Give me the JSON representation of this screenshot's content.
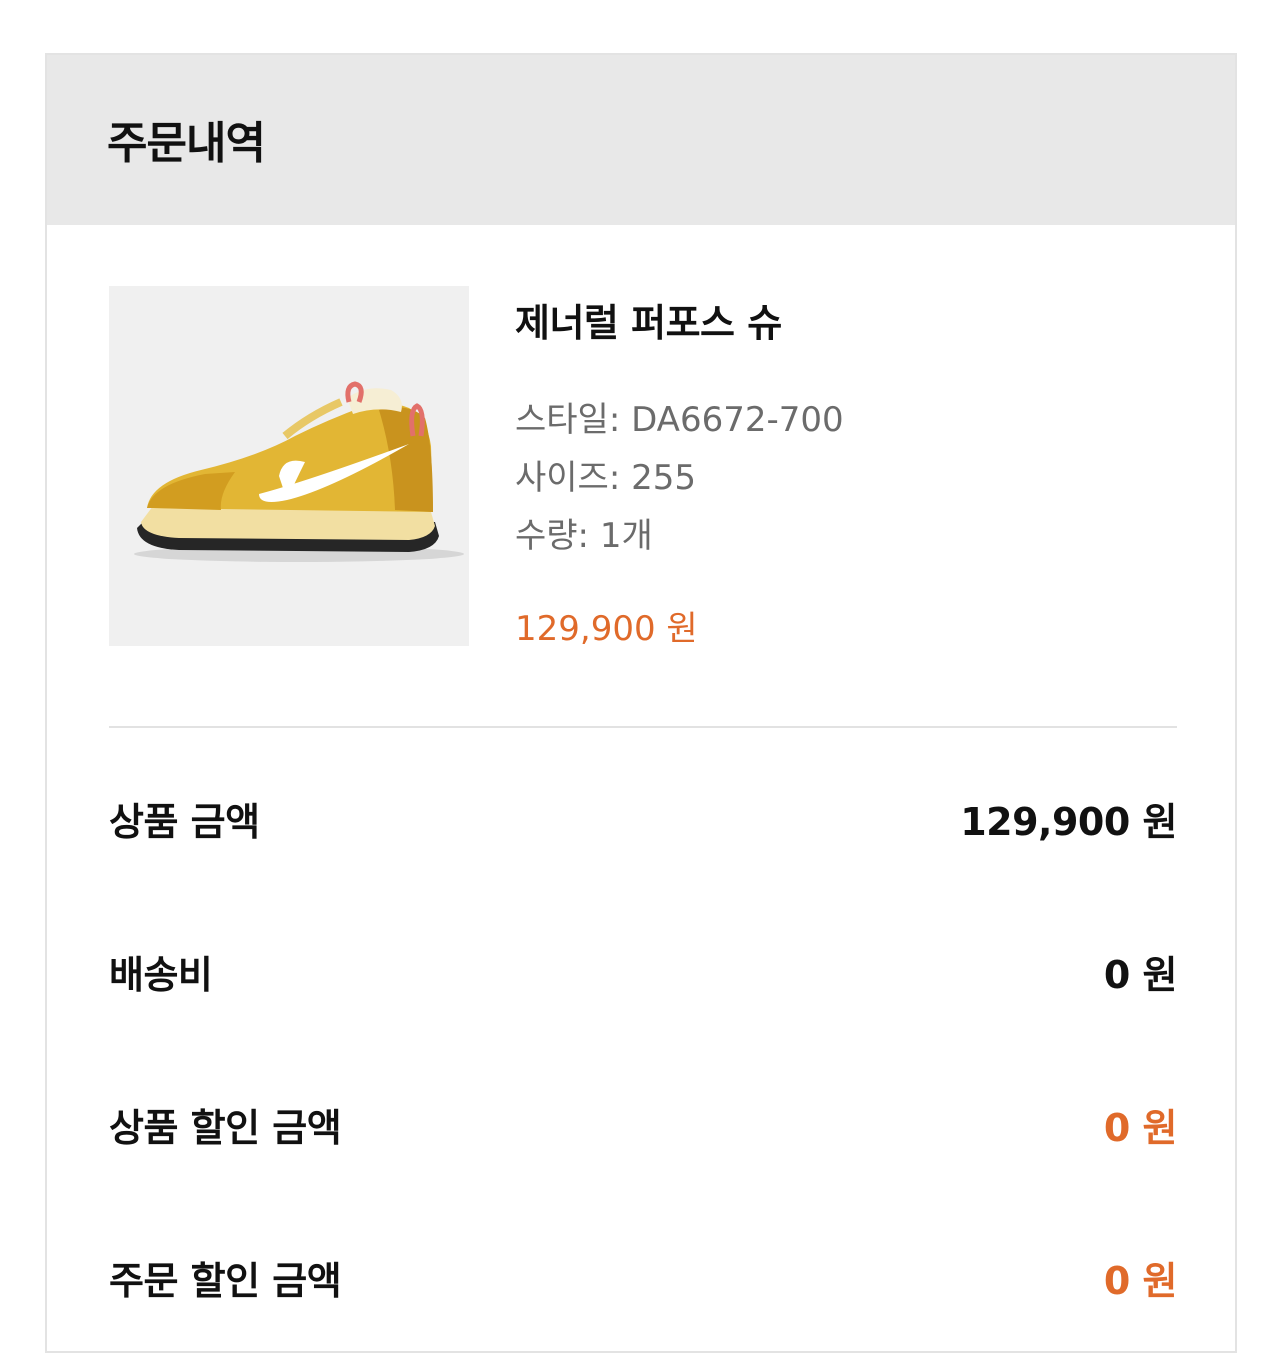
{
  "header": {
    "title": "주문내역"
  },
  "product": {
    "image_icon": "sneaker-image",
    "name": "제너럴 퍼포스 슈",
    "style": "스타일: DA6672-700",
    "size": "사이즈: 255",
    "quantity": "수량: 1개",
    "price": "129,900 원"
  },
  "summary": {
    "items": [
      {
        "label": "상품 금액",
        "value": "129,900 원"
      },
      {
        "label": "배송비",
        "value": "0 원"
      },
      {
        "label": "상품 할인 금액",
        "value": "0 원"
      },
      {
        "label": "주문 할인 금액",
        "value": "0 원"
      }
    ]
  },
  "colors": {
    "accent": "#e06a2a",
    "header_bg": "#e8e8e8",
    "text": "#111111",
    "muted": "#6b6b6b"
  }
}
